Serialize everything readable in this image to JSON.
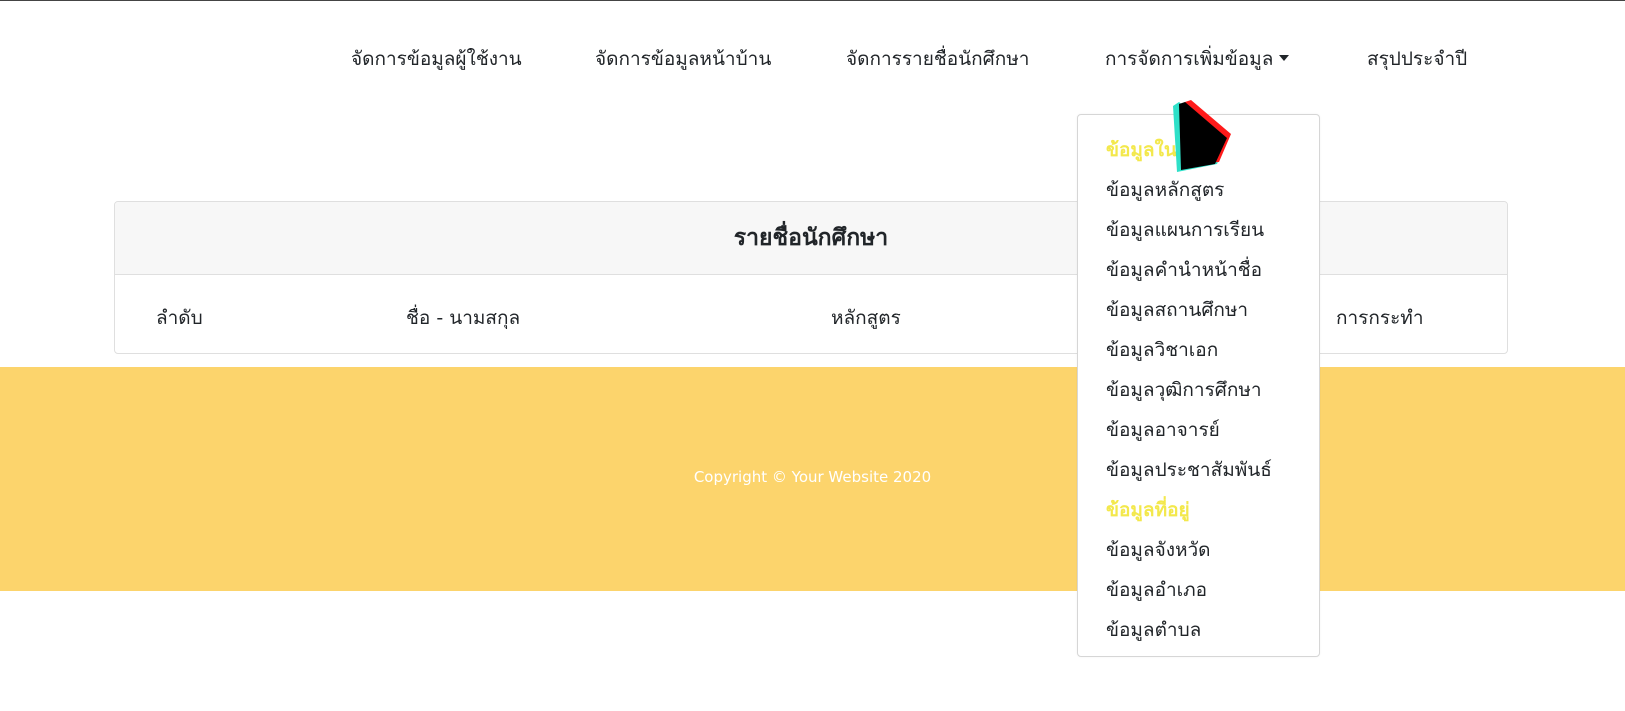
{
  "nav": {
    "items": [
      {
        "label": "จัดการข้อมูลผู้ใช้งาน"
      },
      {
        "label": "จัดการข้อมูลหน้าบ้าน"
      },
      {
        "label": "จัดการรายชื่อนักศึกษา"
      },
      {
        "label": "การจัดการเพิ่มข้อมูล",
        "has_caret": true
      },
      {
        "label": "สรุปประจำปี"
      }
    ]
  },
  "card": {
    "title": "รายชื่อนักศึกษา",
    "columns": [
      "ลำดับ",
      "ชื่อ - นามสกุล",
      "หลักสูตร",
      "การกระทำ"
    ]
  },
  "footer": {
    "copyright": "Copyright © Your Website 2020",
    "background": "#fcd46c"
  },
  "dropdown": {
    "header_color": "#f3e84c",
    "sections": [
      {
        "header": "ข้อมูลใน",
        "items": [
          "ข้อมูลหลักสูตร",
          "ข้อมูลแผนการเรียน",
          "ข้อมูลคำนำหน้าชื่อ",
          "ข้อมูลสถานศึกษา",
          "ข้อมูลวิชาเอก",
          "ข้อมูลวุฒิการศึกษา",
          "ข้อมูลอาจารย์",
          "ข้อมูลประชาสัมพันธ์"
        ]
      },
      {
        "header": "ข้อมูลที่อยู่",
        "items": [
          "ข้อมูลจังหวัด",
          "ข้อมูลอำเภอ",
          "ข้อมูลตำบล"
        ]
      }
    ]
  },
  "cursor": {
    "icon": "pointer-cursor-icon"
  }
}
